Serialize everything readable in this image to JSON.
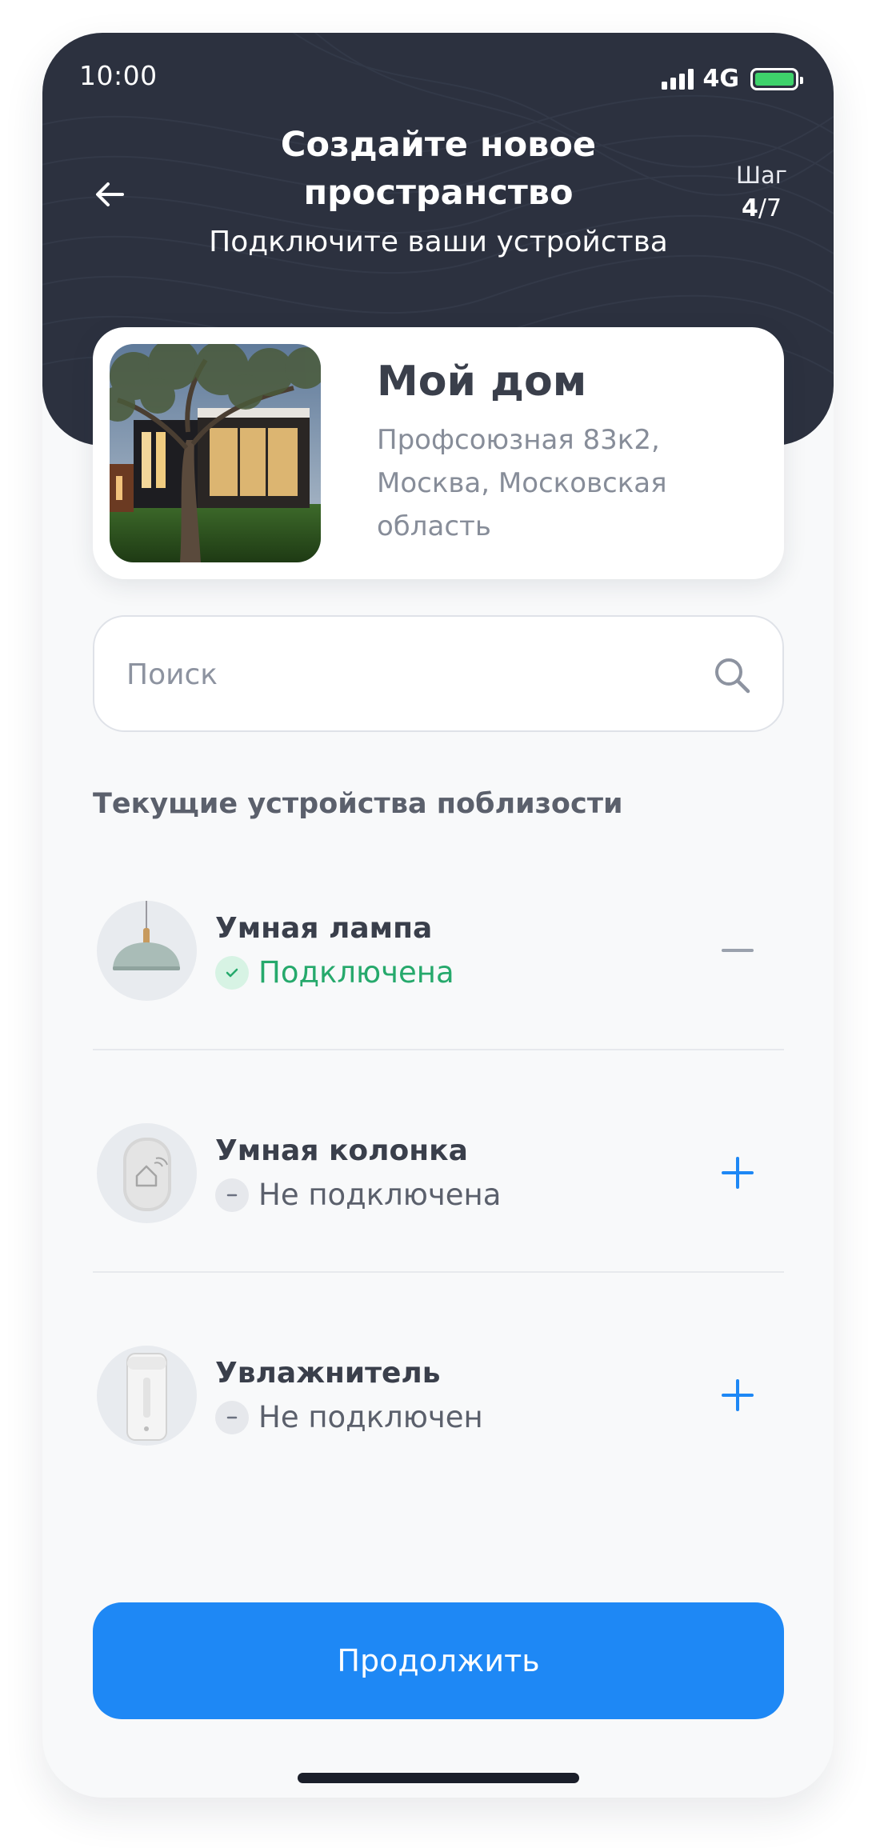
{
  "status_bar": {
    "time": "10:00",
    "network": "4G"
  },
  "header": {
    "title": "Создайте новое пространство",
    "subtitle": "Подключите ваши устройства",
    "step_label": "Шаг",
    "step_current": "4",
    "step_separator": "/",
    "step_total": "7"
  },
  "home": {
    "name": "Мой дом",
    "address": "Профсоюзная 83к2, Москва, Московская область"
  },
  "search": {
    "placeholder": "Поиск",
    "value": ""
  },
  "devices_section": {
    "title": "Текущие устройства поблизости",
    "items": [
      {
        "name": "Умная лампа",
        "status": "Подключена",
        "connected": true,
        "action_icon": "minus-icon"
      },
      {
        "name": "Умная колонка",
        "status": "Не подключена",
        "connected": false,
        "action_icon": "plus-icon"
      },
      {
        "name": "Увлажнитель",
        "status": "Не подключен",
        "connected": false,
        "action_icon": "plus-icon"
      }
    ]
  },
  "continue_button": {
    "label": "Продолжить"
  },
  "colors": {
    "header_bg": "#2c313f",
    "accent": "#1e88f5",
    "connected": "#26a96c",
    "battery": "#3ed26b"
  }
}
